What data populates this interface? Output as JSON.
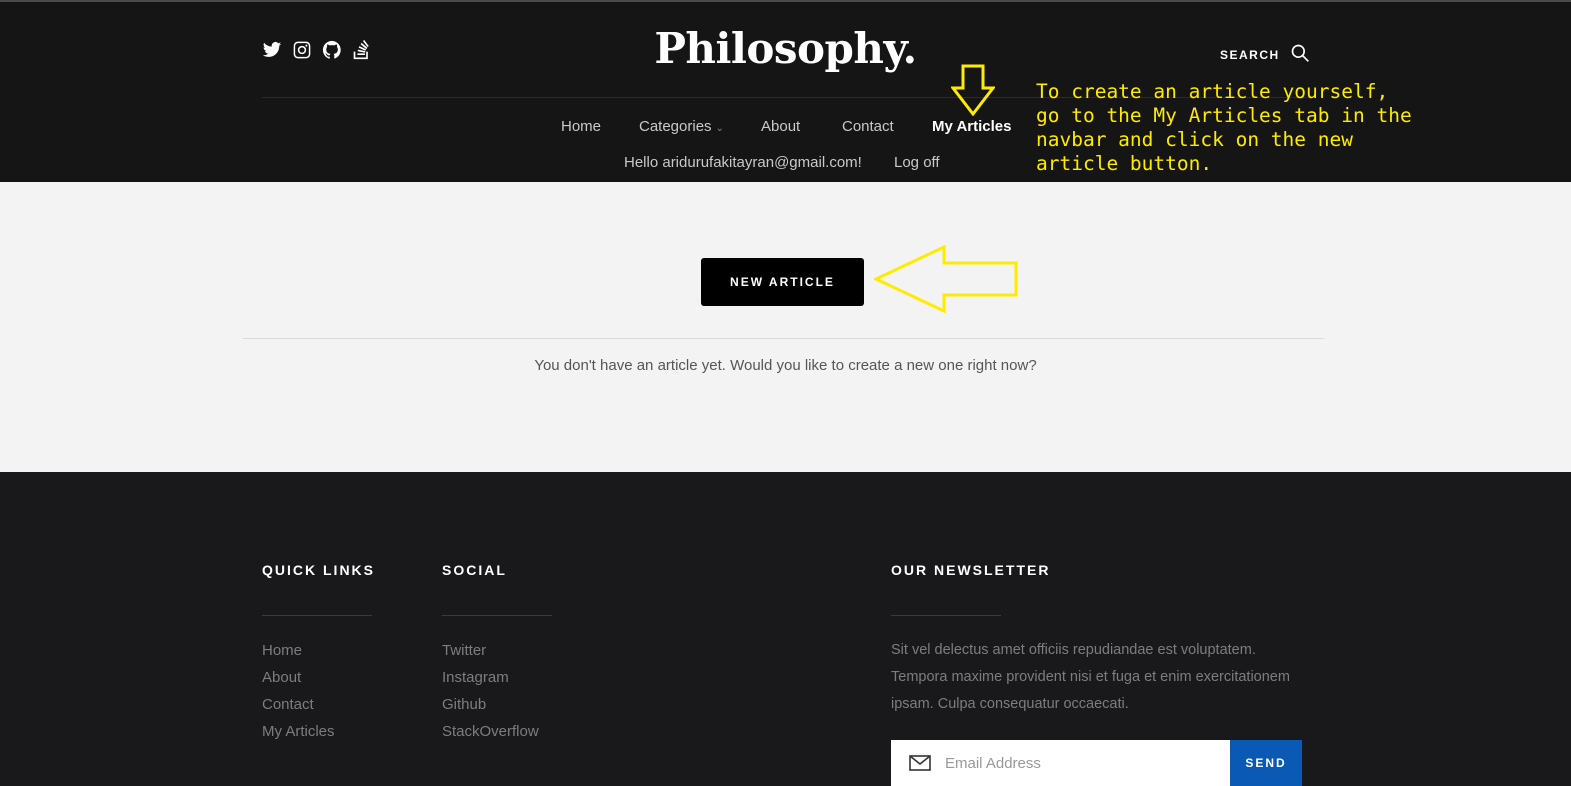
{
  "header": {
    "logo": "Philosophy.",
    "search_label": "SEARCH",
    "social_icons": [
      "twitter-icon",
      "instagram-icon",
      "github-icon",
      "stackoverflow-icon"
    ]
  },
  "nav": {
    "home": "Home",
    "categories": "Categories",
    "about": "About",
    "contact": "Contact",
    "my_articles": "My Articles",
    "greeting": "Hello aridurufakitayran@gmail.com!",
    "logoff": "Log off"
  },
  "annotation": {
    "text": "To create an article yourself,\ngo to the My Articles tab in the\nnavbar and click on the new\narticle button.",
    "color": "#ffeb00"
  },
  "main": {
    "new_article_button": "NEW ARTICLE",
    "empty_message": "You don't have an article yet. Would you like to create a new one right now?"
  },
  "footer": {
    "quick_links": {
      "title": "QUICK LINKS",
      "items": [
        "Home",
        "About",
        "Contact",
        "My Articles"
      ]
    },
    "social": {
      "title": "SOCIAL",
      "items": [
        "Twitter",
        "Instagram",
        "Github",
        "StackOverflow"
      ]
    },
    "newsletter": {
      "title": "OUR NEWSLETTER",
      "text": "Sit vel delectus amet officiis repudiandae est voluptatem. Tempora maxime provident nisi et fuga et enim exercitationem ipsam. Culpa consequatur occaecati.",
      "email_placeholder": "Email Address",
      "send_label": "SEND"
    }
  },
  "colors": {
    "header_bg": "#151515",
    "footer_bg": "#19191b",
    "send_button": "#0a59b5"
  }
}
